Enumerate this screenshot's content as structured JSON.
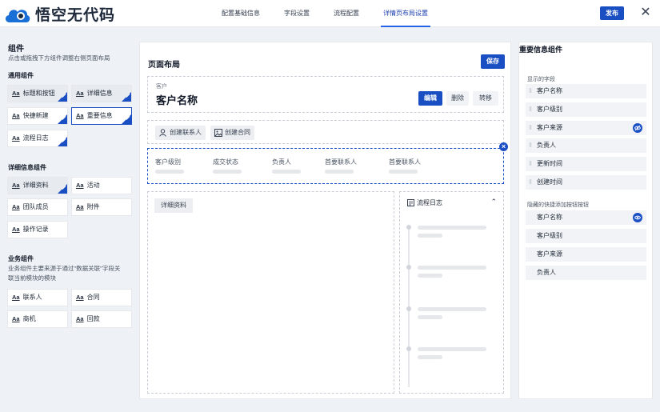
{
  "app": {
    "brand": "悟空无代码"
  },
  "nav": {
    "tabs": [
      "配置基础信息",
      "字段设置",
      "流程配置",
      "详情页布局设置"
    ],
    "active_index": 3
  },
  "header": {
    "publish_label": "发布",
    "close_symbol": "✕"
  },
  "left": {
    "title": "组件",
    "subtitle": "点击或拖拽下方组件调整右侧页面布局",
    "general_title": "通用组件",
    "general_items": [
      "标题和按钮",
      "详细信息",
      "快捷新建",
      "重要信息",
      "流程日志"
    ],
    "detail_title": "详细信息组件",
    "detail_items": [
      "详细资料",
      "活动",
      "团队成员",
      "附件",
      "操作记录"
    ],
    "business_title": "业务组件",
    "business_subtitle_1": "业务组件主要来源于通过\"数据关联\"字段关",
    "business_subtitle_2": "联当前模块的模块",
    "business_items": [
      "联系人",
      "合同",
      "商机",
      "回款"
    ],
    "aa_label": "Aa"
  },
  "center": {
    "title": "页面布局",
    "save_label": "保存",
    "head_label": "客户",
    "head_name": "客户名称",
    "edit_label": "编辑",
    "delete_label": "删除",
    "transfer_label": "转移",
    "quick_buttons": [
      "创建联系人",
      "创建合同"
    ],
    "important_fields": [
      "客户级别",
      "成交状态",
      "负责人",
      "首要联系人",
      "首要联系人"
    ],
    "detail_tag": "详细资料",
    "log_title": "流程日志",
    "close_symbol": "×",
    "chevron": "⌃"
  },
  "right": {
    "title": "重要信息组件",
    "shown_title": "显示的字段",
    "shown_fields": [
      "客户名称",
      "客户级别",
      "客户来源",
      "负责人",
      "更新时间",
      "创建时间"
    ],
    "hidden_title": "隐藏的快捷添加按钮按钮",
    "hidden_fields": [
      "客户名称",
      "客户级别",
      "客户来源",
      "负责人"
    ],
    "grip": "⁝⁝"
  },
  "colors": {
    "accent": "#1a4fc4",
    "background": "#eef1f5"
  }
}
